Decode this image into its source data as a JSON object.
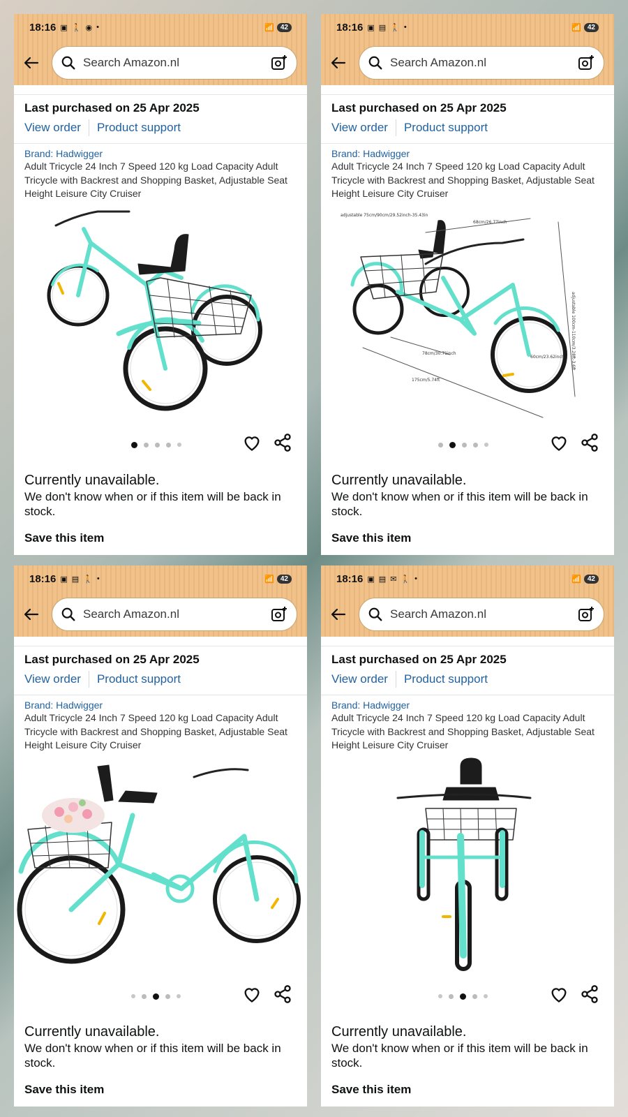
{
  "panels": [
    {
      "status": {
        "time": "18:16",
        "battery": "42"
      },
      "search": {
        "placeholder": "Search Amazon.nl"
      },
      "purchase": {
        "title": "Last purchased on 25 Apr 2025",
        "view_order": "View order",
        "product_support": "Product support"
      },
      "product": {
        "brand": "Brand: Hadwigger",
        "title": "Adult Tricycle 24 Inch 7 Speed 120 kg Load Capacity Adult Tricycle with Backrest and Shopping Basket, Adjustable Seat Height Leisure City Cruiser"
      },
      "carousel": {
        "active_index": 0,
        "count": 5
      },
      "availability": {
        "title": "Currently unavailable.",
        "text": "We don't know when or if this item will be back in stock.",
        "save": "Save this item"
      }
    },
    {
      "status": {
        "time": "18:16",
        "battery": "42"
      },
      "search": {
        "placeholder": "Search Amazon.nl"
      },
      "purchase": {
        "title": "Last purchased on 25 Apr 2025",
        "view_order": "View order",
        "product_support": "Product support"
      },
      "product": {
        "brand": "Brand: Hadwigger",
        "title": "Adult Tricycle 24 Inch 7 Speed 120 kg Load Capacity Adult Tricycle with Backrest and Shopping Basket, Adjustable Seat Height Leisure City Cruiser"
      },
      "dimensions": {
        "seat": "adjustable 75cm/90cm/29.52inch-35.43in",
        "top": "68cm/26.77inch",
        "height": "adjustable 100cm-110cm/3.28ft-3.6ft",
        "wheelbase": "78cm/30.71inch",
        "length": "175cm/5.74ft",
        "wheel": "60cm/23.62inch"
      },
      "carousel": {
        "active_index": 1,
        "count": 5
      },
      "availability": {
        "title": "Currently unavailable.",
        "text": "We don't know when or if this item will be back in stock.",
        "save": "Save this item"
      }
    },
    {
      "status": {
        "time": "18:16",
        "battery": "42"
      },
      "search": {
        "placeholder": "Search Amazon.nl"
      },
      "purchase": {
        "title": "Last purchased on 25 Apr 2025",
        "view_order": "View order",
        "product_support": "Product support"
      },
      "product": {
        "brand": "Brand: Hadwigger",
        "title": "Adult Tricycle 24 Inch 7 Speed 120 kg Load Capacity Adult Tricycle with Backrest and Shopping Basket, Adjustable Seat Height Leisure City Cruiser"
      },
      "carousel": {
        "active_index": 2,
        "count": 5
      },
      "availability": {
        "title": "Currently unavailable.",
        "text": "We don't know when or if this item will be back in stock.",
        "save": "Save this item"
      }
    },
    {
      "status": {
        "time": "18:16",
        "battery": "42"
      },
      "search": {
        "placeholder": "Search Amazon.nl"
      },
      "purchase": {
        "title": "Last purchased on 25 Apr 2025",
        "view_order": "View order",
        "product_support": "Product support"
      },
      "product": {
        "brand": "Brand: Hadwigger",
        "title": "Adult Tricycle 24 Inch 7 Speed 120 kg Load Capacity Adult Tricycle with Backrest and Shopping Basket, Adjustable Seat Height Leisure City Cruiser"
      },
      "carousel": {
        "active_index": 2,
        "count": 5
      },
      "availability": {
        "title": "Currently unavailable.",
        "text": "We don't know when or if this item will be back in stock.",
        "save": "Save this item"
      }
    }
  ],
  "colors": {
    "header": "#f0c189",
    "link": "#2162a1",
    "frame": "#62e0cc",
    "tire": "#1a1a1a"
  },
  "icons": {
    "back": "back-arrow-icon",
    "search": "search-icon",
    "camera": "camera-icon",
    "heart": "heart-icon",
    "share": "share-icon"
  }
}
